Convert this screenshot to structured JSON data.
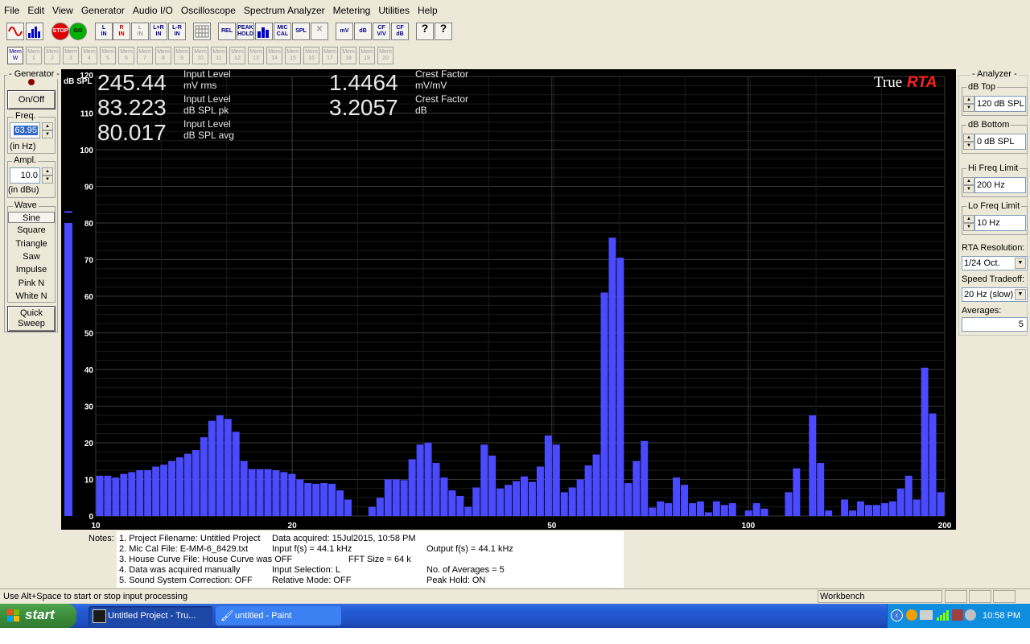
{
  "menu": [
    "File",
    "Edit",
    "View",
    "Generator",
    "Audio I/O",
    "Oscilloscope",
    "Spectrum Analyzer",
    "Metering",
    "Utilities",
    "Help"
  ],
  "toolbar": {
    "sine_icon": "sine-wave-icon",
    "spectrum_icon": "spectrum-icon",
    "stop": "STOP",
    "go": "GO",
    "l_in": "L\nIN",
    "r_in": "R\nIN",
    "l_in2": "L\nIN",
    "lr_in": "L+R\nIN",
    "l_r_in": "L-R\nIN",
    "rel": "REL",
    "peak_hold": "PEAK\nHOLD",
    "mic_cal": "MIC\nCAL",
    "spl": "SPL",
    "mv": "mV",
    "db": "dB",
    "cf_vv": "CF\nV/V",
    "cf_db": "CF\ndB",
    "help": "?",
    "context_help": "?"
  },
  "mem_buttons": [
    "Mem\nW",
    "Mem\n1",
    "Mem\n2",
    "Mem\n3",
    "Mem\n4",
    "Mem\n5",
    "Mem\n6",
    "Mem\n7",
    "Mem\n8",
    "Mem\n9",
    "Mem\n10",
    "Mem\n11",
    "Mem\n12",
    "Mem\n13",
    "Mem\n14",
    "Mem\n15",
    "Mem\n16",
    "Mem\n17",
    "Mem\n18",
    "Mem\n19",
    "Mem\n20"
  ],
  "generator": {
    "title": "- Generator -",
    "on_off": "On/Off",
    "freq_label": "Freq.",
    "freq_value": "63.95",
    "freq_unit": "(in Hz)",
    "ampl_label": "Ampl.",
    "ampl_value": "10.0",
    "ampl_unit": "(in dBu)",
    "wave_title": "Wave",
    "waves": [
      "Sine",
      "Square",
      "Triangle",
      "Saw",
      "Impulse",
      "Pink N",
      "White N"
    ],
    "selected_wave": "Sine",
    "quick_sweep": "Quick\nSweep"
  },
  "readouts": [
    {
      "value": "245.44",
      "label1": "Input Level",
      "label2": "mV rms"
    },
    {
      "value": "83.223",
      "label1": "Input Level",
      "label2": "dB SPL pk"
    },
    {
      "value": "80.017",
      "label1": "Input Level",
      "label2": "dB SPL avg"
    },
    {
      "value": "1.4464",
      "label1": "Crest Factor",
      "label2": "mV/mV"
    },
    {
      "value": "3.2057",
      "label1": "Crest Factor",
      "label2": "dB"
    }
  ],
  "logo": {
    "part1": "True",
    "part2": "RTA"
  },
  "chart_data": {
    "type": "bar",
    "ylabel": "dB SPL",
    "ylim": [
      0,
      120
    ],
    "y_ticks": [
      0,
      10,
      20,
      30,
      40,
      50,
      60,
      70,
      80,
      90,
      100,
      110,
      120
    ],
    "xlim": [
      10,
      200
    ],
    "x_scale": "log",
    "x_ticks": [
      10,
      20,
      50,
      100,
      200
    ],
    "grid": true,
    "level_meter": {
      "value": 80.0,
      "peak": 83.0
    },
    "bar_color": "#4a4aff",
    "values": [
      11,
      11,
      10.5,
      11.5,
      12,
      12.5,
      12.5,
      13.5,
      14,
      15,
      16,
      17,
      18,
      21.5,
      26,
      27.5,
      26.5,
      23,
      15,
      12.8,
      12.8,
      12.8,
      12.5,
      12,
      11.5,
      10,
      9,
      8.8,
      9,
      8.8,
      7,
      4.5,
      0,
      0,
      2.5,
      5,
      10,
      10,
      9.8,
      15.5,
      19.5,
      20,
      14.5,
      10.5,
      7,
      5.5,
      2.5,
      7.8,
      19.5,
      16.5,
      7.5,
      8.5,
      9.5,
      10.8,
      9.3,
      13.5,
      22,
      19.5,
      6.5,
      7.8,
      10,
      13.8,
      16.8,
      61,
      76,
      70.5,
      9,
      15,
      20.5,
      2.3,
      4,
      3.5,
      10.5,
      8.5,
      3.5,
      4,
      1,
      4,
      3,
      3.5,
      0,
      1.5,
      3.5,
      2,
      0,
      0,
      6.5,
      13,
      0,
      27.5,
      14.5,
      1.5,
      0,
      4.5,
      1.5,
      4,
      3,
      3,
      3.5,
      4,
      7.5,
      11,
      4.5,
      40.5,
      28,
      6.5
    ]
  },
  "analyzer": {
    "title": "- Analyzer -",
    "db_top_label": "dB Top",
    "db_top": "120 dB SPL",
    "db_bottom_label": "dB Bottom",
    "db_bottom": "0 dB SPL",
    "hi_freq_label": "Hi Freq Limit",
    "hi_freq": "200 Hz",
    "lo_freq_label": "Lo Freq Limit",
    "lo_freq": "10 Hz",
    "rta_res_label": "RTA Resolution:",
    "rta_res": "1/24 Oct.",
    "speed_label": "Speed Tradeoff:",
    "speed": "20 Hz (slow)",
    "averages_label": "Averages:",
    "averages": "5"
  },
  "notes": {
    "title": "Notes:",
    "lines": [
      {
        "a": "1. Project Filename: Untitled Project",
        "b": "Data acquired: 15Jul2015, 10:58 PM",
        "c": ""
      },
      {
        "a": "2. Mic Cal File: E-MM-6_8429.txt",
        "b": "Input f(s) = 44.1 kHz",
        "c": "Output f(s) = 44.1 kHz"
      },
      {
        "a": "3. House Curve File: House Curve was OFF",
        "b": "FFT Size = 64 k",
        "c": ""
      },
      {
        "a": "4. Data was acquired manually",
        "b": "Input Selection: L",
        "c": "No. of Averages = 5"
      },
      {
        "a": "5. Sound System Correction: OFF",
        "b": "Relative Mode:  OFF",
        "c": "Peak Hold: ON"
      }
    ]
  },
  "status": {
    "hint": "Use Alt+Space to start or stop input processing",
    "mode": "Workbench"
  },
  "taskbar": {
    "start": "start",
    "tasks": [
      "Untitled Project - Tru...",
      "untitled - Paint"
    ],
    "clock": "10:58 PM"
  }
}
